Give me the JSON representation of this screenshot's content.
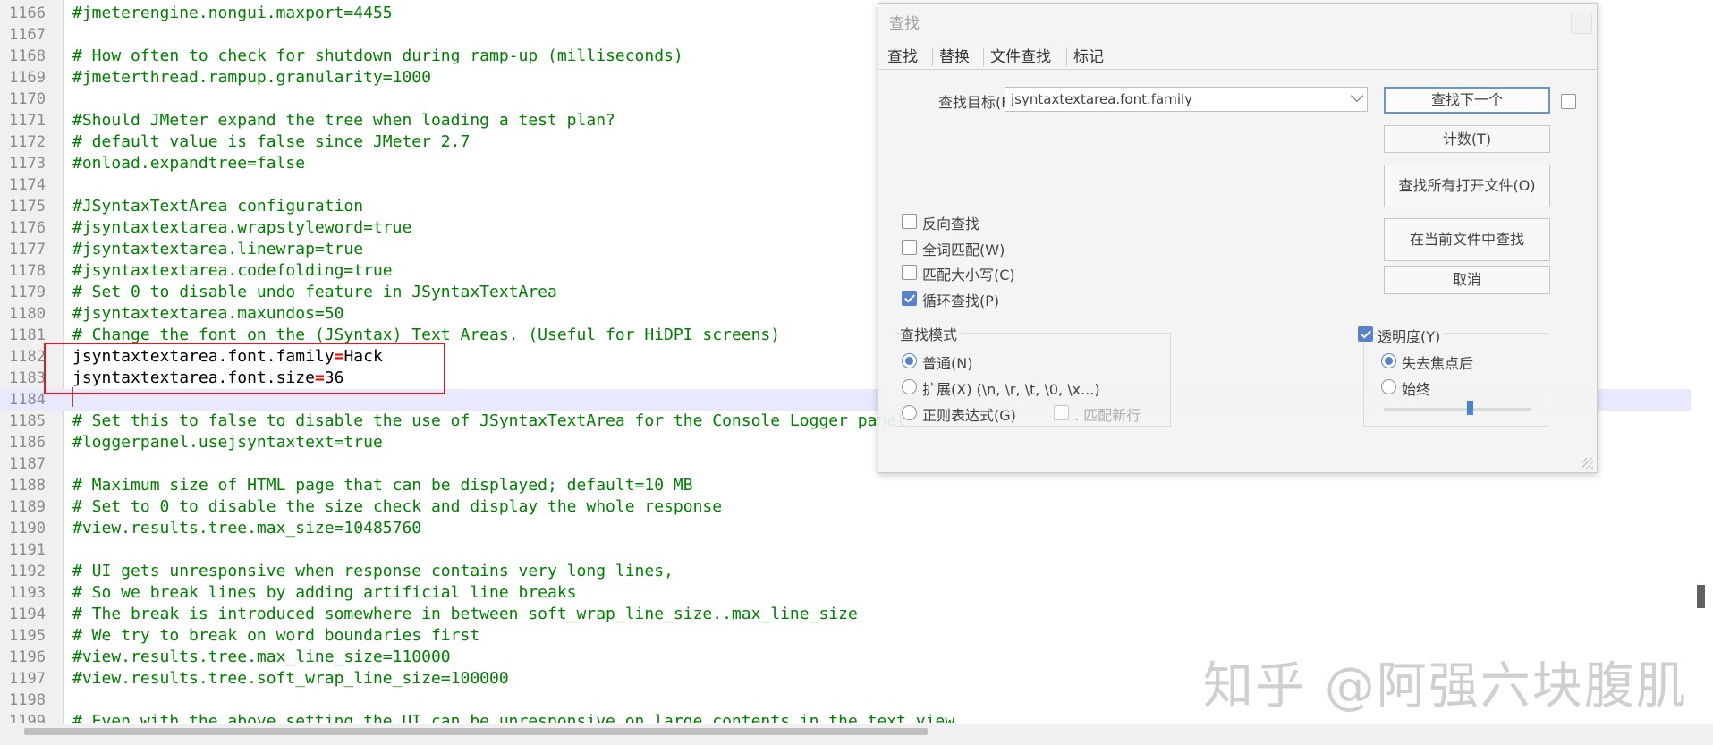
{
  "editor": {
    "lines": [
      {
        "num": "1166",
        "text": "#jmeterengine.nongui.maxport=4455",
        "kind": "comment"
      },
      {
        "num": "1167",
        "text": "",
        "kind": "plain"
      },
      {
        "num": "1168",
        "text": "# How often to check for shutdown during ramp-up (milliseconds)",
        "kind": "comment"
      },
      {
        "num": "1169",
        "text": "#jmeterthread.rampup.granularity=1000",
        "kind": "comment"
      },
      {
        "num": "1170",
        "text": "",
        "kind": "plain"
      },
      {
        "num": "1171",
        "text": "#Should JMeter expand the tree when loading a test plan?",
        "kind": "comment"
      },
      {
        "num": "1172",
        "text": "# default value is false since JMeter 2.7",
        "kind": "comment"
      },
      {
        "num": "1173",
        "text": "#onload.expandtree=false",
        "kind": "comment"
      },
      {
        "num": "1174",
        "text": "",
        "kind": "plain"
      },
      {
        "num": "1175",
        "text": "#JSyntaxTextArea configuration",
        "kind": "comment"
      },
      {
        "num": "1176",
        "text": "#jsyntaxtextarea.wrapstyleword=true",
        "kind": "comment"
      },
      {
        "num": "1177",
        "text": "#jsyntaxtextarea.linewrap=true",
        "kind": "comment"
      },
      {
        "num": "1178",
        "text": "#jsyntaxtextarea.codefolding=true",
        "kind": "comment"
      },
      {
        "num": "1179",
        "text": "# Set 0 to disable undo feature in JSyntaxTextArea",
        "kind": "comment"
      },
      {
        "num": "1180",
        "text": "#jsyntaxtextarea.maxundos=50",
        "kind": "comment"
      },
      {
        "num": "1181",
        "text": "# Change the font on the (JSyntax) Text Areas. (Useful for HiDPI screens)",
        "kind": "comment"
      },
      {
        "num": "1182",
        "key": "jsyntaxtextarea.font.family",
        "eq": "=",
        "val": "Hack",
        "kind": "setting"
      },
      {
        "num": "1183",
        "key": "jsyntaxtextarea.font.size",
        "eq": "=",
        "val": "36",
        "kind": "setting"
      },
      {
        "num": "1184",
        "text": "",
        "kind": "current"
      },
      {
        "num": "1185",
        "text": "# Set this to false to disable the use of JSyntaxTextArea for the Console Logger panel",
        "kind": "comment"
      },
      {
        "num": "1186",
        "text": "#loggerpanel.usejsyntaxtext=true",
        "kind": "comment"
      },
      {
        "num": "1187",
        "text": "",
        "kind": "plain"
      },
      {
        "num": "1188",
        "text": "# Maximum size of HTML page that can be displayed; default=10 MB",
        "kind": "comment"
      },
      {
        "num": "1189",
        "text": "# Set to 0 to disable the size check and display the whole response",
        "kind": "comment"
      },
      {
        "num": "1190",
        "text": "#view.results.tree.max_size=10485760",
        "kind": "comment"
      },
      {
        "num": "1191",
        "text": "",
        "kind": "plain"
      },
      {
        "num": "1192",
        "text": "# UI gets unresponsive when response contains very long lines,",
        "kind": "comment"
      },
      {
        "num": "1193",
        "text": "# So we break lines by adding artificial line breaks",
        "kind": "comment"
      },
      {
        "num": "1194",
        "text": "# The break is introduced somewhere in between soft_wrap_line_size..max_line_size",
        "kind": "comment"
      },
      {
        "num": "1195",
        "text": "# We try to break on word boundaries first",
        "kind": "comment"
      },
      {
        "num": "1196",
        "text": "#view.results.tree.max_line_size=110000",
        "kind": "comment"
      },
      {
        "num": "1197",
        "text": "#view.results.tree.soft_wrap_line_size=100000",
        "kind": "comment"
      },
      {
        "num": "1198",
        "text": "",
        "kind": "plain"
      },
      {
        "num": "1199",
        "text": "# Even with the above setting the UI can be unresponsive on large contents in the text view",
        "kind": "comment"
      }
    ]
  },
  "watermark": "知乎 @阿强六块腹肌",
  "find_dialog": {
    "title": "查找",
    "tabs": [
      "查找",
      "替换",
      "文件查找",
      "标记"
    ],
    "active_tab": "查找",
    "target_label": "查找目标(F)：",
    "target_value": "jsyntaxtextarea.font.family",
    "buttons": {
      "find_next": "查找下一个",
      "count": "计数(T)",
      "find_all_open": "查找所有打开文件(O)",
      "find_in_current": "在当前文件中查找",
      "cancel": "取消"
    },
    "options": {
      "reverse": {
        "label": "反向查找",
        "checked": false
      },
      "whole_word": {
        "label": "全词匹配(W)",
        "checked": false
      },
      "match_case": {
        "label": "匹配大小写(C)",
        "checked": false
      },
      "wrap": {
        "label": "循环查找(P)",
        "checked": true
      }
    },
    "mode": {
      "group_label": "查找模式",
      "normal": "普通(N)",
      "extended": "扩展(X) (\\n, \\r, \\t, \\0, \\x...)",
      "regex": "正则表达式(G)",
      "match_newline": ". 匹配新行",
      "selected": "normal"
    },
    "transparency": {
      "label": "透明度(Y)",
      "checked": true,
      "on_lose_focus": "失去焦点后",
      "always": "始终",
      "selected": "on_lose_focus",
      "level": 0.58
    }
  }
}
